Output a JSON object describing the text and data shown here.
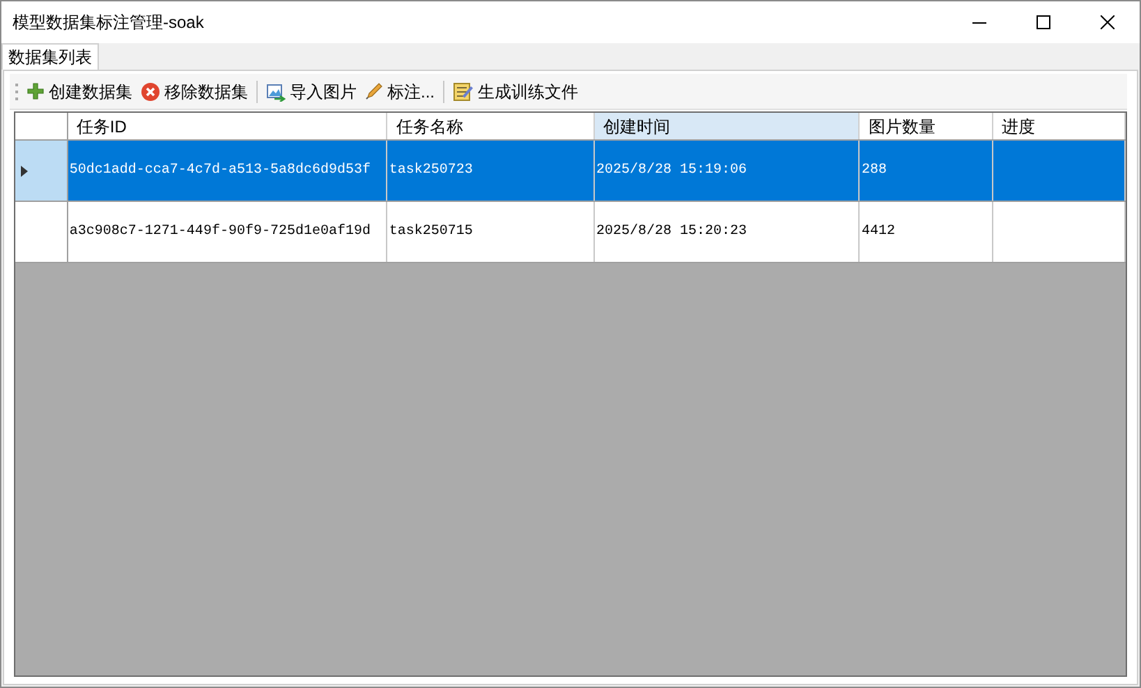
{
  "window": {
    "title": "模型数据集标注管理-soak"
  },
  "tabs": [
    {
      "label": "数据集列表",
      "selected": true
    }
  ],
  "toolbar": [
    {
      "kind": "plus",
      "label": "创建数据集"
    },
    {
      "kind": "remove",
      "label": "移除数据集"
    },
    {
      "kind": "separator"
    },
    {
      "kind": "import",
      "label": "导入图片"
    },
    {
      "kind": "pencil",
      "label": "标注..."
    },
    {
      "kind": "separator"
    },
    {
      "kind": "notepad",
      "label": "生成训练文件"
    }
  ],
  "table": {
    "columns": [
      {
        "label": "任务ID",
        "selected": false
      },
      {
        "label": "任务名称",
        "selected": false
      },
      {
        "label": "创建时间",
        "selected": true
      },
      {
        "label": "图片数量",
        "selected": false
      },
      {
        "label": "进度",
        "selected": false
      }
    ],
    "rows": [
      {
        "selected": true,
        "cells": [
          "50dc1add-cca7-4c7d-a513-5a8dc6d9d53f",
          "task250723",
          "2025/8/28 15:19:06",
          "288",
          ""
        ]
      },
      {
        "selected": false,
        "cells": [
          "a3c908c7-1271-449f-90f9-725d1e0af19d",
          "task250715",
          "2025/8/28 15:20:23",
          "4412",
          ""
        ]
      }
    ]
  }
}
